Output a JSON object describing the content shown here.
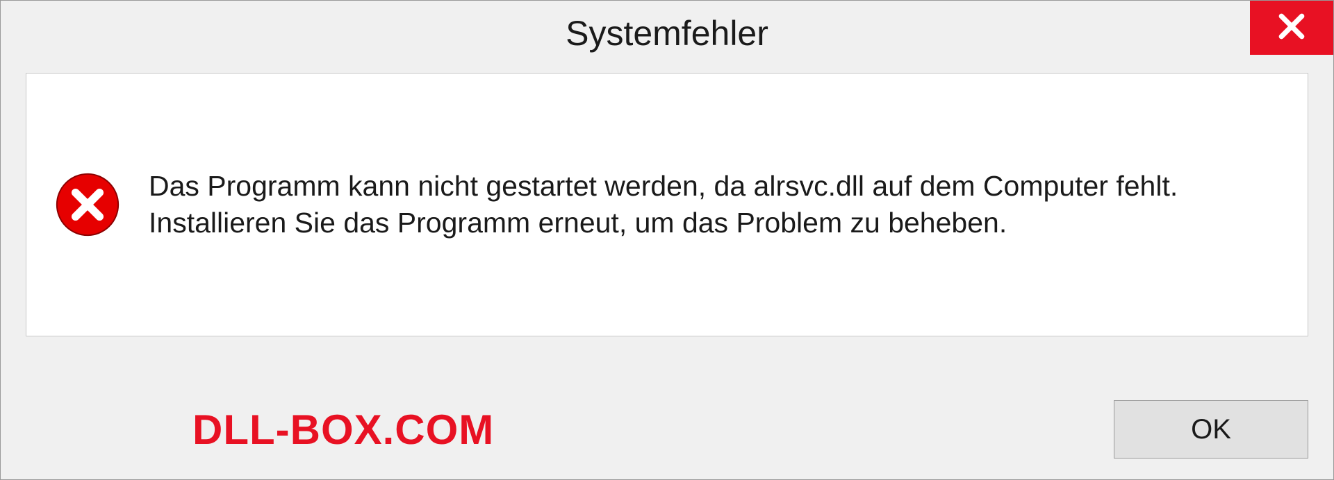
{
  "dialog": {
    "title": "Systemfehler",
    "message": "Das Programm kann nicht gestartet werden, da alrsvc.dll auf dem Computer fehlt. Installieren Sie das Programm erneut, um das Problem zu beheben.",
    "ok_label": "OK"
  },
  "watermark": {
    "text": "DLL-BOX.COM"
  },
  "colors": {
    "close_button": "#e81123",
    "watermark": "#e81123"
  }
}
